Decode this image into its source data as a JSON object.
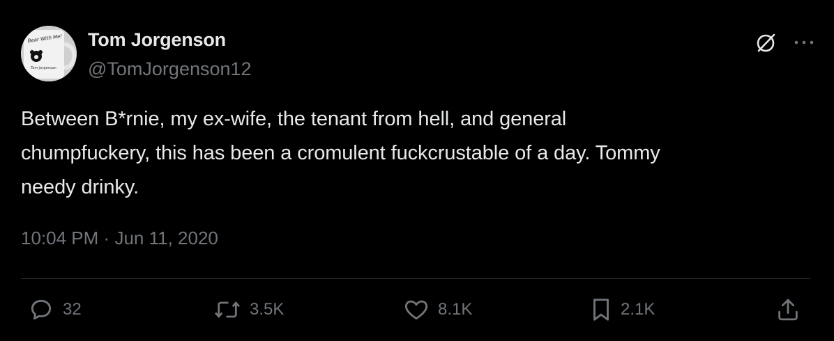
{
  "author": {
    "display_name": "Tom Jorgenson",
    "handle": "@TomJorgenson12",
    "avatar_icon": "mug-avatar-photo",
    "avatar_text": "Bear With Me!"
  },
  "tweet": {
    "text": "Between B*rnie, my ex-wife, the tenant from hell, and general\nchumpfuckery, this has been a cromulent fuckcrustable of a day. Tommy\nneedy drinky.",
    "time": "10:04 PM",
    "separator": "·",
    "date": "Jun 11, 2020"
  },
  "top_icons": [
    "grok-icon",
    "more-icon"
  ],
  "actions": {
    "replies": "32",
    "reposts": "3.5K",
    "likes": "8.1K",
    "bookmarks": "2.1K"
  },
  "colors": {
    "background": "#000000",
    "text_primary": "#e7e9ea",
    "text_secondary": "#71767b",
    "divider": "#2f3336"
  }
}
